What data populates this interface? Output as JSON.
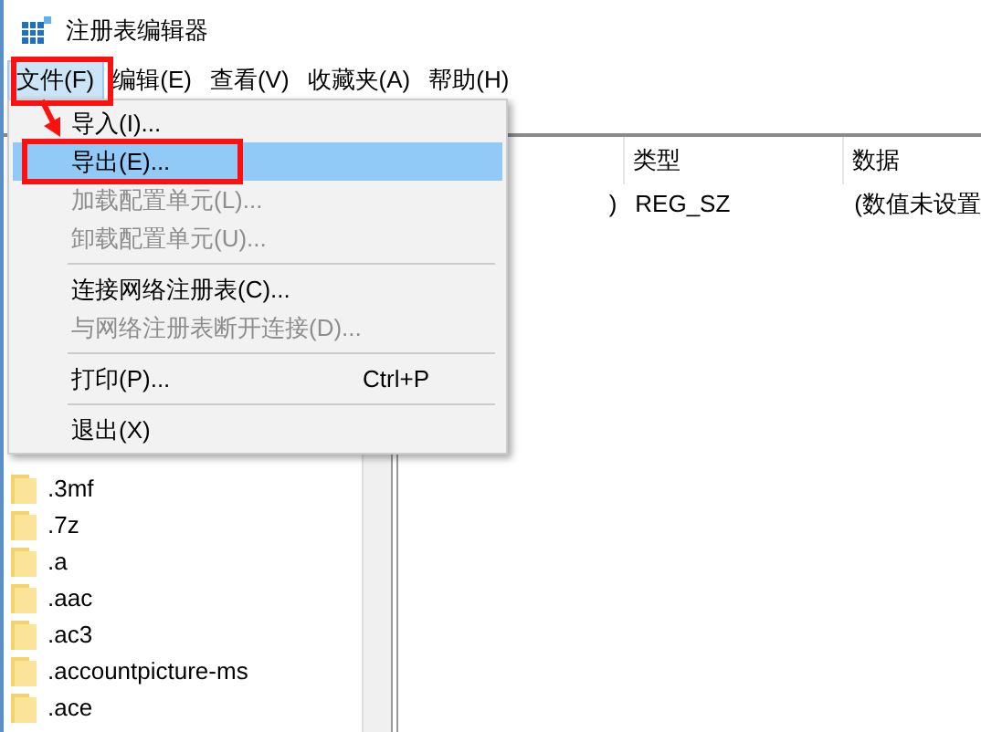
{
  "window": {
    "title": "注册表编辑器"
  },
  "menu_bar": [
    {
      "label": "文件(F)",
      "selected": true
    },
    {
      "label": "编辑(E)",
      "selected": false
    },
    {
      "label": "查看(V)",
      "selected": false
    },
    {
      "label": "收藏夹(A)",
      "selected": false
    },
    {
      "label": "帮助(H)",
      "selected": false
    }
  ],
  "file_menu": {
    "items": [
      {
        "kind": "item",
        "label": "导入(I)...",
        "disabled": false,
        "selected": false
      },
      {
        "kind": "item",
        "label": "导出(E)...",
        "disabled": false,
        "selected": true
      },
      {
        "kind": "item",
        "label": "加载配置单元(L)...",
        "disabled": true,
        "selected": false
      },
      {
        "kind": "item",
        "label": "卸载配置单元(U)...",
        "disabled": true,
        "selected": false
      },
      {
        "kind": "separator"
      },
      {
        "kind": "item",
        "label": "连接网络注册表(C)...",
        "disabled": false,
        "selected": false
      },
      {
        "kind": "item",
        "label": "与网络注册表断开连接(D)...",
        "disabled": true,
        "selected": false
      },
      {
        "kind": "separator"
      },
      {
        "kind": "item",
        "label": "打印(P)...",
        "shortcut": "Ctrl+P",
        "disabled": false,
        "selected": false
      },
      {
        "kind": "separator"
      },
      {
        "kind": "item",
        "label": "退出(X)",
        "disabled": false,
        "selected": false
      }
    ]
  },
  "tree": {
    "items": [
      ".3mf",
      ".7z",
      ".a",
      ".aac",
      ".ac3",
      ".accountpicture-ms",
      ".ace"
    ]
  },
  "values": {
    "columns": [
      "类型",
      "数据"
    ],
    "rows": [
      {
        "name": ")",
        "type": "REG_SZ",
        "data": "(数值未设置"
      }
    ]
  }
}
